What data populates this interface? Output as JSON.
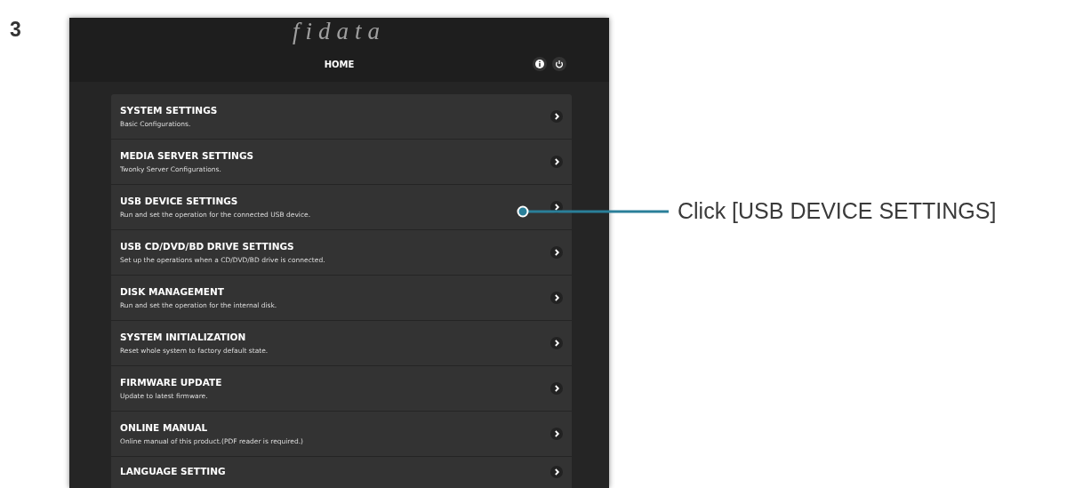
{
  "step_number": "3",
  "screen": {
    "logo": "fidata",
    "title": "HOME",
    "menu_items": [
      {
        "title": "SYSTEM SETTINGS",
        "description": "Basic Configurations."
      },
      {
        "title": "MEDIA SERVER SETTINGS",
        "description": "Twonky Server Configurations."
      },
      {
        "title": "USB DEVICE SETTINGS",
        "description": "Run and set the operation for the connected USB device."
      },
      {
        "title": "USB CD/DVD/BD DRIVE SETTINGS",
        "description": "Set up the operations when a CD/DVD/BD drive is connected."
      },
      {
        "title": "DISK MANAGEMENT",
        "description": "Run and set the operation for the internal disk."
      },
      {
        "title": "SYSTEM INITIALIZATION",
        "description": "Reset whole system to factory default state."
      },
      {
        "title": "FIRMWARE UPDATE",
        "description": "Update to latest firmware."
      },
      {
        "title": "ONLINE MANUAL",
        "description": "Online manual of this product.(PDF reader is required.)"
      },
      {
        "title": "LANGUAGE SETTING"
      }
    ]
  },
  "callout": {
    "text": "Click [USB DEVICE SETTINGS]"
  }
}
